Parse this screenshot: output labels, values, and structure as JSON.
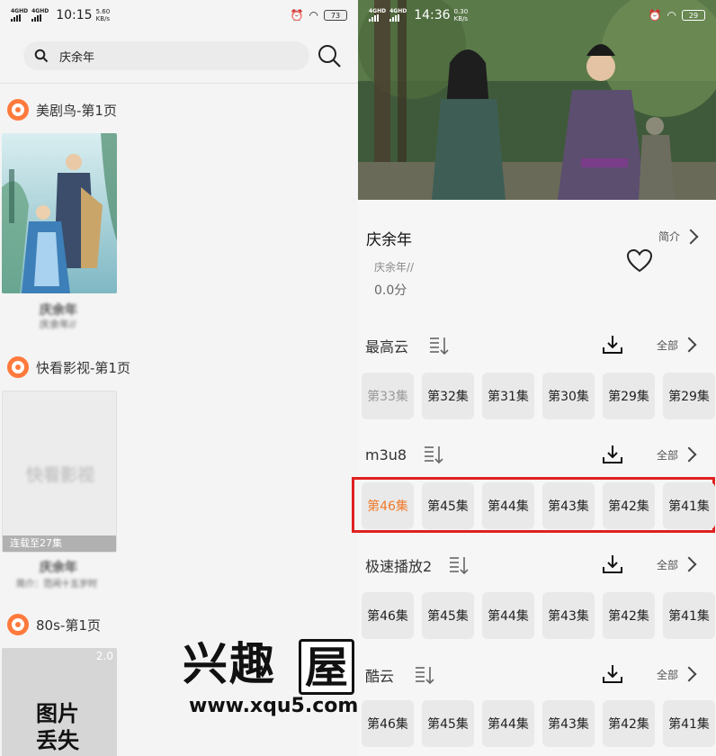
{
  "left_status": {
    "network": "4GHD",
    "time": "10:15",
    "speed_num": "5.60",
    "speed_unit": "KB/s",
    "battery": "73"
  },
  "right_status": {
    "network": "4GHD",
    "time": "14:36",
    "speed_num": "0.30",
    "speed_unit": "KB/s",
    "battery": "29"
  },
  "search": {
    "query": "庆余年"
  },
  "sources": [
    {
      "header": "美剧鸟-第1页",
      "title": "庆余年",
      "subtitle": "庆余年//"
    },
    {
      "header": "快看影视-第1页",
      "placeholder_text": "快看影视",
      "update_note": "连载至27集",
      "title": "庆余年",
      "subtitle": "简介：范闲十五岁时"
    },
    {
      "header": "80s-第1页",
      "badge": "2.0",
      "placeholder_text": "图片丢失"
    }
  ],
  "detail": {
    "title": "庆余年",
    "intro_label": "简介",
    "subtitle": "庆余年//",
    "score": "0.0分"
  },
  "lines": [
    {
      "name": "最高云",
      "all_label": "全部",
      "episodes": [
        "第33集",
        "第32集",
        "第31集",
        "第30集",
        "第29集",
        "第29集"
      ],
      "highlight": false
    },
    {
      "name": "m3u8",
      "all_label": "全部",
      "episodes": [
        "第46集",
        "第45集",
        "第44集",
        "第43集",
        "第42集",
        "第41集"
      ],
      "highlight": true
    },
    {
      "name": "极速播放2",
      "all_label": "全部",
      "episodes": [
        "第46集",
        "第45集",
        "第44集",
        "第43集",
        "第42集",
        "第41集"
      ],
      "highlight": false
    },
    {
      "name": "酷云",
      "all_label": "全部",
      "episodes": [
        "第46集",
        "第45集",
        "第44集",
        "第43集",
        "第42集",
        "第41集"
      ],
      "highlight": false
    }
  ],
  "watermark": {
    "brand": "兴趣屋",
    "url": "www.xqu5.com"
  },
  "colors": {
    "accent": "#ff7a3c",
    "highlight_box": "#e02020",
    "active_episode": "#f07a2a"
  }
}
